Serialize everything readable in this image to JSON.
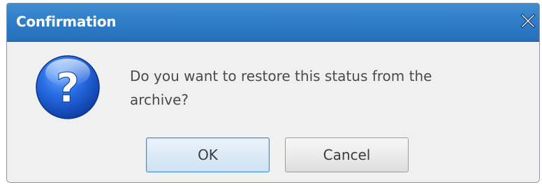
{
  "dialog": {
    "title": "Confirmation",
    "close_icon": "close-icon",
    "message": "Do you want to restore this status from the archive?",
    "icon": "question-icon",
    "buttons": {
      "ok_label": "OK",
      "cancel_label": "Cancel"
    }
  },
  "colors": {
    "titlebar": "#2f7cc7",
    "body_background": "#f0f0f0",
    "ok_border": "#3c8ed1",
    "icon_blue": "#1e63d6"
  }
}
